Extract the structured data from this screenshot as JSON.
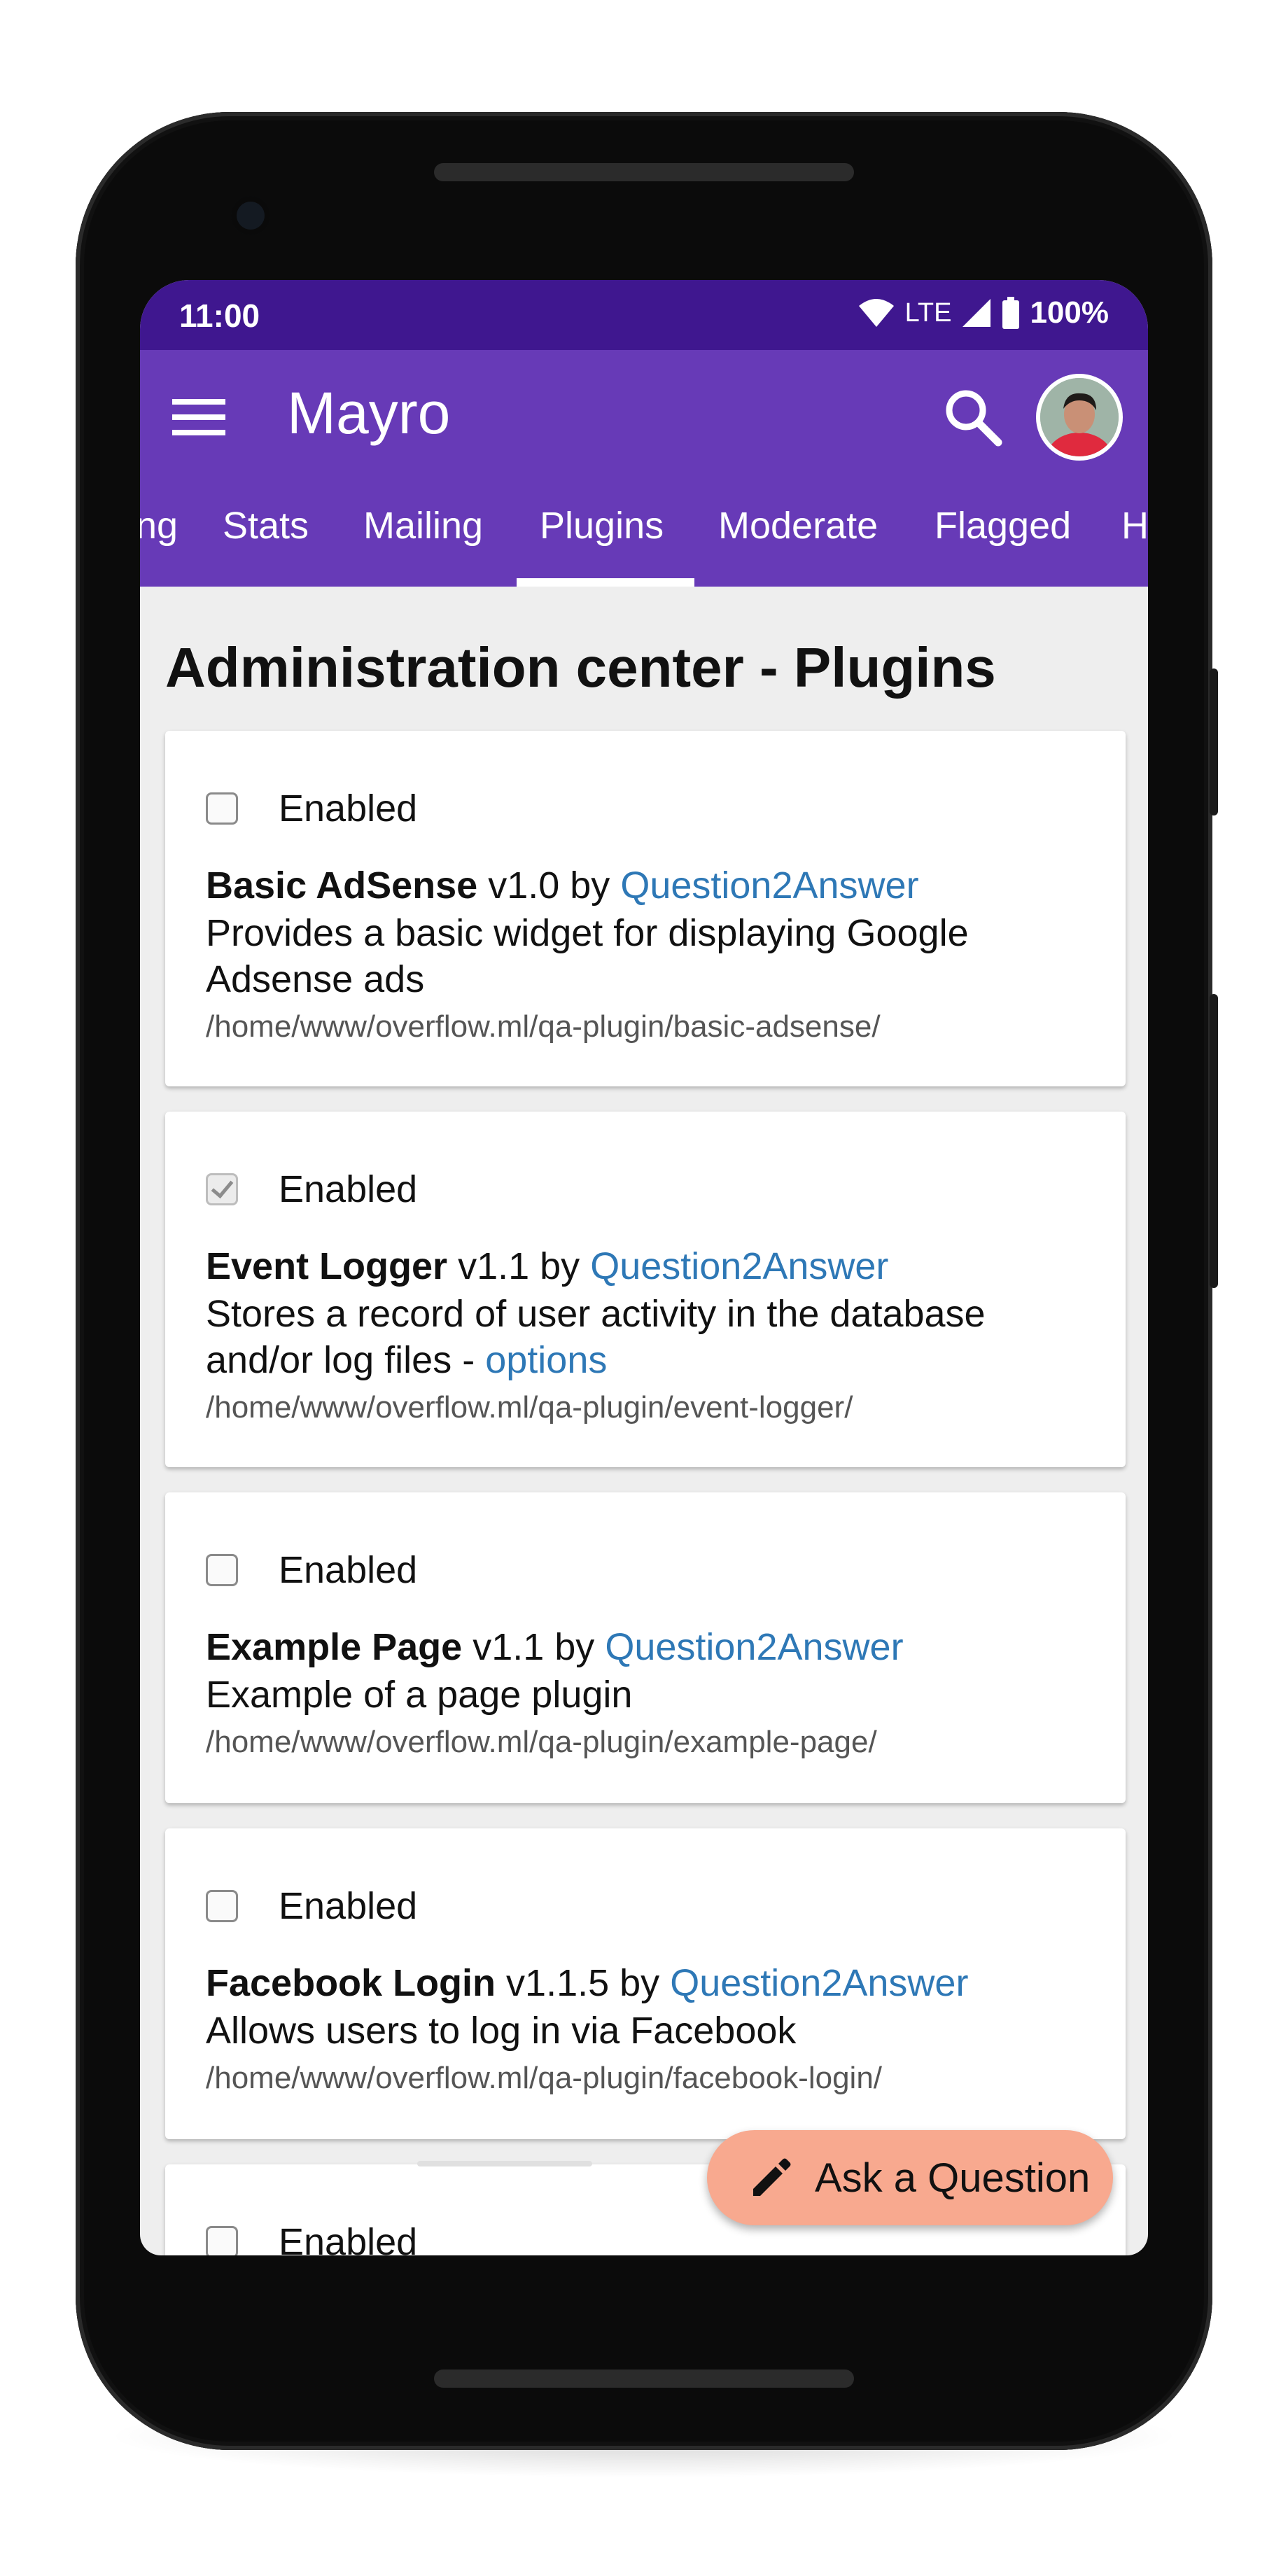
{
  "status_bar": {
    "time": "11:00",
    "network": "LTE",
    "battery": "100%",
    "icons": [
      "wifi-icon",
      "signal-icon",
      "battery-icon"
    ]
  },
  "app_bar": {
    "title": "Mayro",
    "menu_icon": "hamburger-menu-icon",
    "search_icon": "search-icon",
    "avatar": "user-avatar"
  },
  "tabs": [
    {
      "label": "ng"
    },
    {
      "label": "Stats"
    },
    {
      "label": "Mailing"
    },
    {
      "label": "Plugins",
      "selected": true
    },
    {
      "label": "Moderate"
    },
    {
      "label": "Flagged"
    },
    {
      "label": "H"
    }
  ],
  "page": {
    "title": "Administration center - Plugins"
  },
  "plugins": [
    {
      "enabled_label": "Enabled",
      "checked": false,
      "name": "Basic AdSense",
      "version": "v1.0 by",
      "author": "Question2Answer",
      "description": "Provides a basic widget for displaying Google Adsense ads",
      "path": "/home/www/overflow.ml/qa-plugin/basic-adsense/"
    },
    {
      "enabled_label": "Enabled",
      "checked": true,
      "name": "Event Logger",
      "version": "v1.1 by",
      "author": "Question2Answer",
      "description": "Stores a record of user activity in the database and/or log files -",
      "options_link": "options",
      "path": "/home/www/overflow.ml/qa-plugin/event-logger/"
    },
    {
      "enabled_label": "Enabled",
      "checked": false,
      "name": "Example Page",
      "version": "v1.1 by",
      "author": "Question2Answer",
      "description": "Example of a page plugin",
      "path": "/home/www/overflow.ml/qa-plugin/example-page/"
    },
    {
      "enabled_label": "Enabled",
      "checked": false,
      "name": "Facebook Login",
      "version": "v1.1.5 by",
      "author": "Question2Answer",
      "description": "Allows users to log in via Facebook",
      "path": "/home/www/overflow.ml/qa-plugin/facebook-login/"
    },
    {
      "enabled_label": "Enabled",
      "checked": false
    }
  ],
  "fab": {
    "label": "Ask a Question",
    "icon": "pencil-icon"
  },
  "colors": {
    "status_bar": "#3f178f",
    "app_bar": "#673ab7",
    "link": "#2e78b6",
    "fab": "#f8a98f"
  }
}
